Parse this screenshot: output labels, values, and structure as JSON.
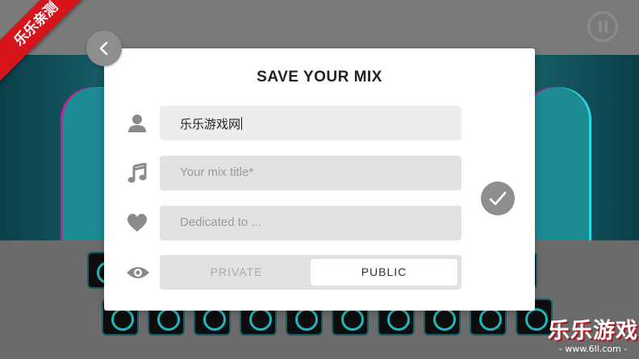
{
  "badge": {
    "text": "乐乐亲测"
  },
  "watermark": {
    "main": "乐乐游戏",
    "sub": "- www.6ll.com -"
  },
  "dialog": {
    "title": "SAVE YOUR MIX",
    "author_field": {
      "value": "乐乐游戏网",
      "icon": "user-icon"
    },
    "title_field": {
      "placeholder": "Your mix title*",
      "icon": "music-note-icon"
    },
    "dedication_field": {
      "placeholder": "Dedicated to ...",
      "icon": "heart-icon"
    },
    "visibility": {
      "icon": "eye-icon",
      "options": [
        "PRIVATE",
        "PUBLIC"
      ],
      "selected": "PUBLIC"
    },
    "back_icon": "chevron-left-icon",
    "confirm_icon": "checkmark-icon"
  },
  "controls": {
    "pause_icon": "pause-icon"
  },
  "colors": {
    "badge": "#d5141c",
    "stage": "#0d4650",
    "accent": "#25d6e0",
    "button": "#8e8e8e"
  }
}
